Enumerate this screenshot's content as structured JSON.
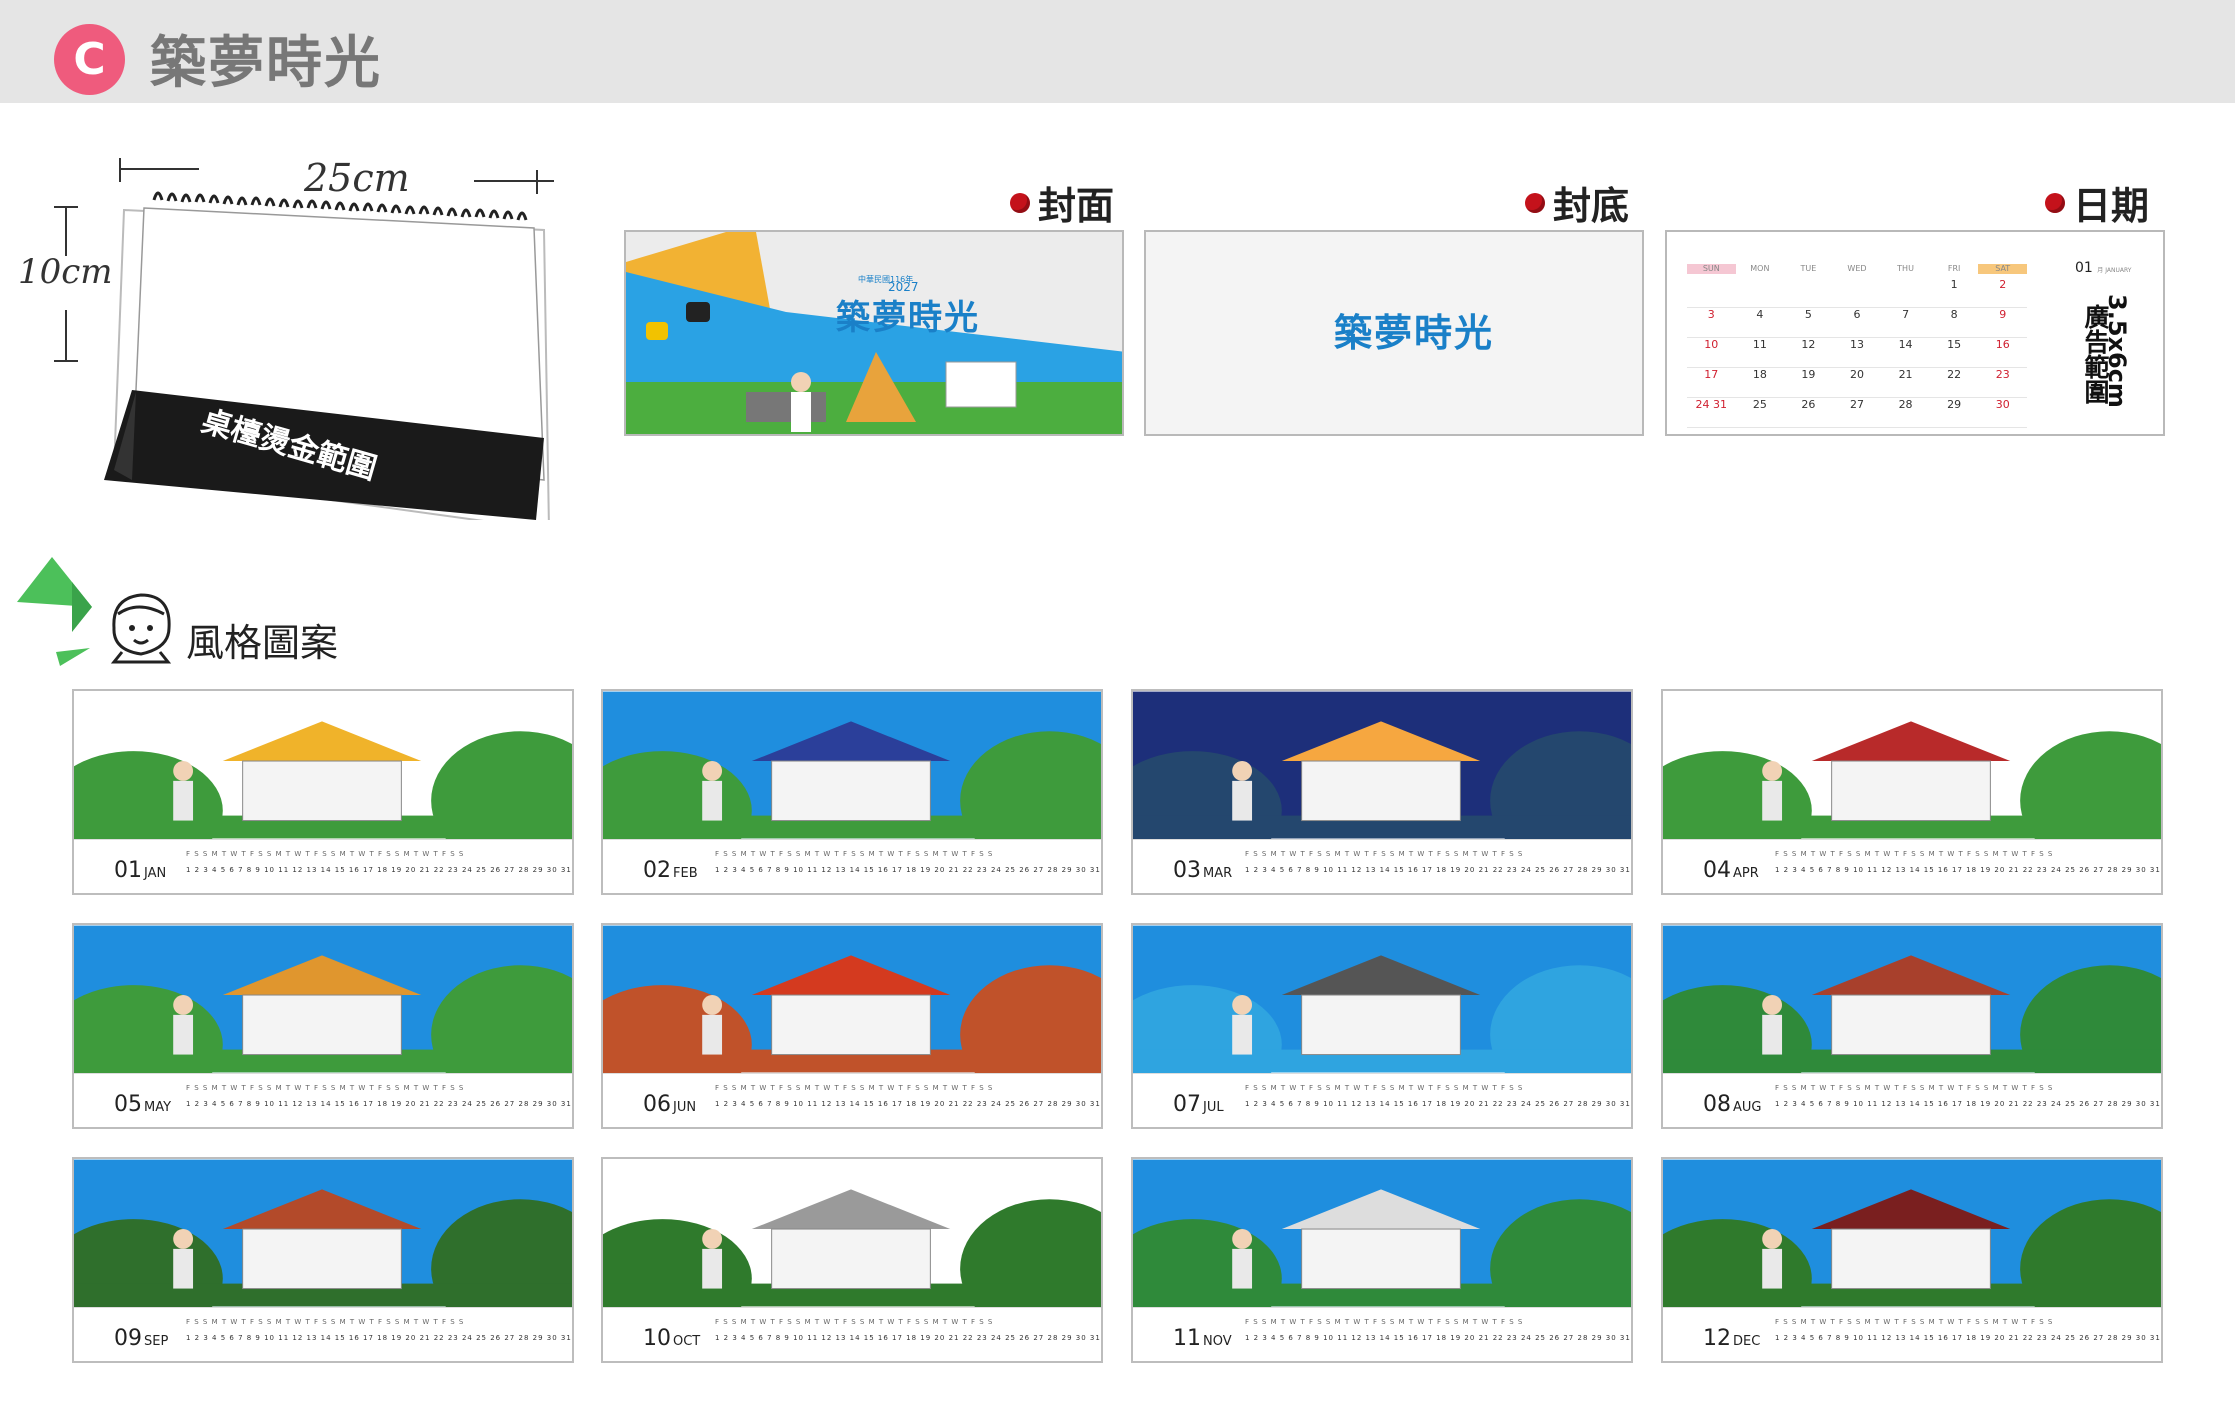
{
  "header": {
    "badge": "C",
    "title": "築夢時光"
  },
  "desk": {
    "width_label": "25cm",
    "height_label": "10cm",
    "base_label": "桌檯燙金範圍"
  },
  "previews": {
    "cover_label": "封面",
    "back_label": "封底",
    "date_label": "日期",
    "logo": "築夢時光",
    "cover_small": "中華民國116年",
    "cover_year": "2027",
    "ad_label": "3.5x6cm",
    "ad_label2": "廣告範圍",
    "cal_month": "01",
    "cal_month_sub": "月 JANUARY",
    "cal_headers": [
      "SUN",
      "MON",
      "TUE",
      "WED",
      "THU",
      "FRI",
      "SAT"
    ],
    "cal_rows": [
      [
        "",
        "",
        "",
        "",
        "",
        "1",
        "2"
      ],
      [
        "3",
        "4",
        "5",
        "6",
        "7",
        "8",
        "9"
      ],
      [
        "10",
        "11",
        "12",
        "13",
        "14",
        "15",
        "16"
      ],
      [
        "17",
        "18",
        "19",
        "20",
        "21",
        "22",
        "23"
      ],
      [
        "24 31",
        "25",
        "26",
        "27",
        "28",
        "29",
        "30"
      ]
    ]
  },
  "style_section": {
    "title": "風格圖案"
  },
  "months": [
    {
      "num": "01",
      "abbr": "JAN"
    },
    {
      "num": "02",
      "abbr": "FEB"
    },
    {
      "num": "03",
      "abbr": "MAR"
    },
    {
      "num": "04",
      "abbr": "APR"
    },
    {
      "num": "05",
      "abbr": "MAY"
    },
    {
      "num": "06",
      "abbr": "JUN"
    },
    {
      "num": "07",
      "abbr": "JUL"
    },
    {
      "num": "08",
      "abbr": "AUG"
    },
    {
      "num": "09",
      "abbr": "SEP"
    },
    {
      "num": "10",
      "abbr": "OCT"
    },
    {
      "num": "11",
      "abbr": "NOV"
    },
    {
      "num": "12",
      "abbr": "DEC"
    }
  ],
  "days_weekdays": "F S S M T W T F S S M T W T F S S M T W T F S S M T W T F S S",
  "days_numbers": "1 2 3 4 5 6 7 8 9 10 11 12 13 14 15 16 17 18 19 20 21 22 23 24 25 26 27 28 29 30 31",
  "colors": {
    "accent_pink": "#ef5b7d",
    "header_bg": "#e5e5e5",
    "dot_red": "#c4121b",
    "sky_blue": "#1f8ede"
  }
}
